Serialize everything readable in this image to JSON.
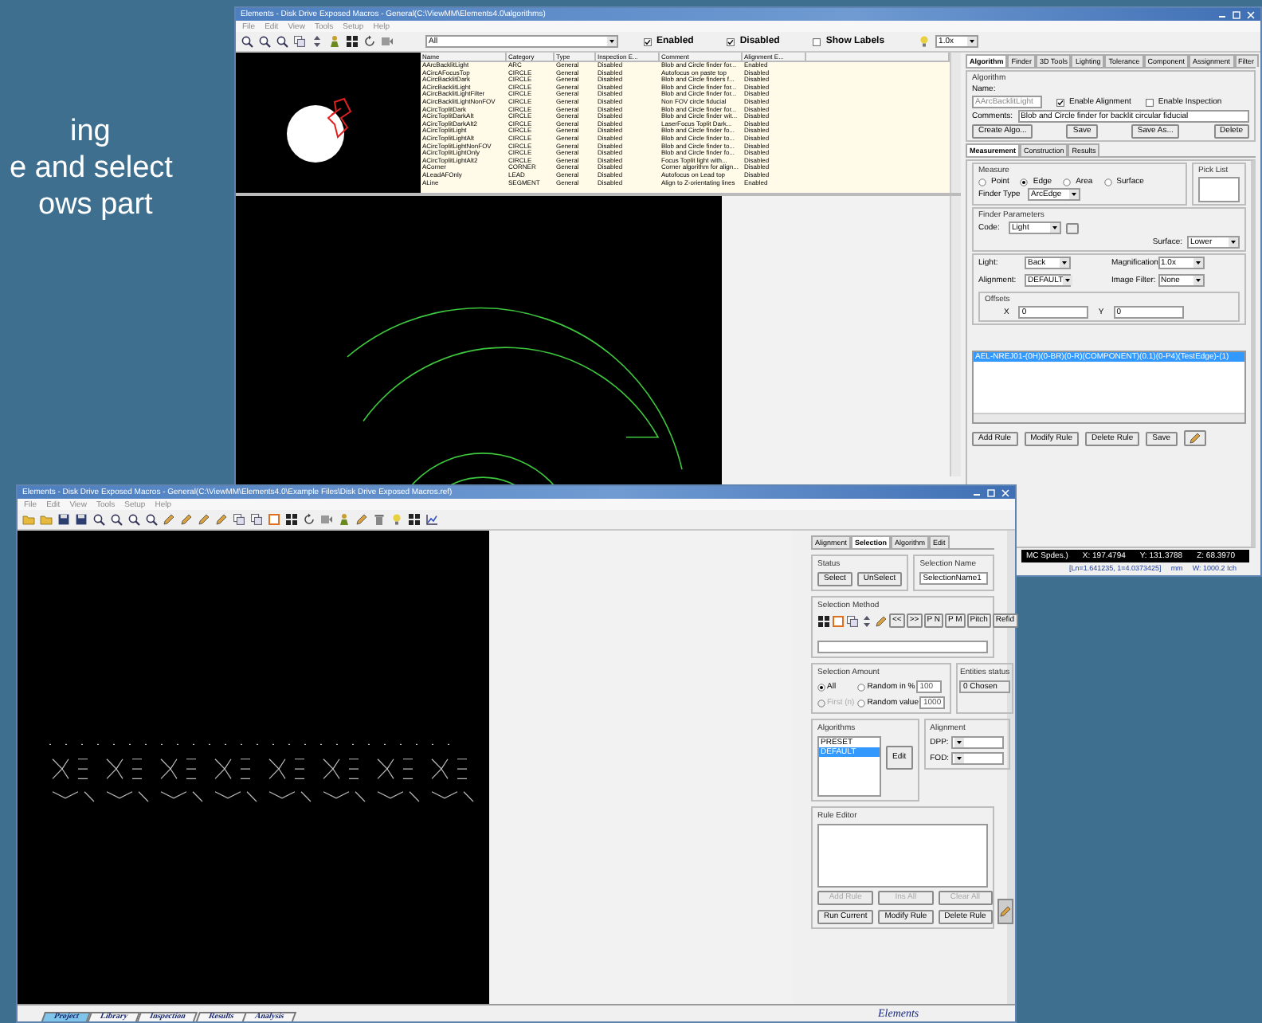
{
  "slide_text": [
    "ing",
    "e and select",
    "ows part"
  ],
  "top_window": {
    "title": "Elements - Disk Drive Exposed Macros - General(C:\\ViewMM\\Elements4.0\\algorithms)",
    "menu": [
      "File",
      "Edit",
      "View",
      "Tools",
      "Setup",
      "Help"
    ],
    "filter": "All",
    "toggles": [
      {
        "label": "Enabled",
        "checked": true
      },
      {
        "label": "Disabled",
        "checked": true
      },
      {
        "label": "Show Labels",
        "checked": false
      }
    ],
    "zoom": "1.0x",
    "table": {
      "columns": [
        "Name",
        "Category",
        "Type",
        "Inspection E...",
        "Comment",
        "Alignment E..."
      ],
      "rows": [
        [
          "AArcBacklitLight",
          "ARC",
          "General",
          "Disabled",
          "Blob and Circle finder for...",
          "Enabled"
        ],
        [
          "ACircAFocusTop",
          "CIRCLE",
          "General",
          "Disabled",
          "Autofocus on paste top",
          "Disabled"
        ],
        [
          "ACircBacklitDark",
          "CIRCLE",
          "General",
          "Disabled",
          "Blob and Circle finders f...",
          "Disabled"
        ],
        [
          "ACircBacklitLight",
          "CIRCLE",
          "General",
          "Disabled",
          "Blob and Circle finder for...",
          "Disabled"
        ],
        [
          "ACircBacklitLightFilter",
          "CIRCLE",
          "General",
          "Disabled",
          "Blob and Circle finder for...",
          "Disabled"
        ],
        [
          "ACircBacklitLightNonFOV",
          "CIRCLE",
          "General",
          "Disabled",
          "Non FOV circle fiducial",
          "Disabled"
        ],
        [
          "ACircToplitDark",
          "CIRCLE",
          "General",
          "Disabled",
          "Blob and Circle finder for...",
          "Disabled"
        ],
        [
          "ACircToplitDarkAlt",
          "CIRCLE",
          "General",
          "Disabled",
          "Blob and Circle finder wit...",
          "Disabled"
        ],
        [
          "ACircToplitDarkAlt2",
          "CIRCLE",
          "General",
          "Disabled",
          "LaserFocus Toplit Dark...",
          "Disabled"
        ],
        [
          "ACircToplitLight",
          "CIRCLE",
          "General",
          "Disabled",
          "Blob and Circle finder fo...",
          "Disabled"
        ],
        [
          "ACircToplitLightAlt",
          "CIRCLE",
          "General",
          "Disabled",
          "Blob and Circle finder to...",
          "Disabled"
        ],
        [
          "ACircToplitLightNonFOV",
          "CIRCLE",
          "General",
          "Disabled",
          "Blob and Circle finder to...",
          "Disabled"
        ],
        [
          "ACircToplitLightOnly",
          "CIRCLE",
          "General",
          "Disabled",
          "Blob and Circle finder fo...",
          "Disabled"
        ],
        [
          "ACircToplitLightAlt2",
          "CIRCLE",
          "General",
          "Disabled",
          "Focus Toplit light with...",
          "Disabled"
        ],
        [
          "ACorner",
          "CORNER",
          "General",
          "Disabled",
          "Corner algorithm for align...",
          "Disabled"
        ],
        [
          "ALeadAFOnly",
          "LEAD",
          "General",
          "Disabled",
          "Autofocus on Lead top",
          "Disabled"
        ],
        [
          "ALine",
          "SEGMENT",
          "General",
          "Disabled",
          "Align to Z-orientating lines",
          "Enabled"
        ]
      ]
    },
    "panel": {
      "tabs": [
        {
          "label": "Algorithm",
          "selected": true
        },
        {
          "label": "Finder",
          "selected": false
        },
        {
          "label": "3D Tools",
          "selected": false
        },
        {
          "label": "Lighting",
          "selected": false
        },
        {
          "label": "Tolerance",
          "selected": false
        },
        {
          "label": "Component",
          "selected": false
        },
        {
          "label": "Assignment",
          "selected": false
        },
        {
          "label": "Filter",
          "selected": false
        }
      ],
      "group_title": "Algorithm",
      "name_label": "Name:",
      "name_value": "AArcBacklitLight",
      "options": [
        {
          "label": "Enable Alignment",
          "checked": true
        },
        {
          "label": "Enable Inspection",
          "checked": false
        }
      ],
      "comments_label": "Comments:",
      "comments_value": "Blob and Circle finder for backlit circular fiducial",
      "buttons": [
        "Create Algo...",
        "Save",
        "Save As...",
        "Delete"
      ],
      "subtabs": [
        {
          "label": "Measurement",
          "selected": true
        },
        {
          "label": "Construction",
          "selected": false
        },
        {
          "label": "Results",
          "selected": false
        }
      ],
      "measure_title": "Measure",
      "measure": [
        {
          "label": "Point",
          "selected": false
        },
        {
          "label": "Edge",
          "selected": true
        },
        {
          "label": "Area",
          "selected": false
        },
        {
          "label": "Surface",
          "selected": false
        }
      ],
      "finder_type_label": "Finder Type",
      "finder_type": "ArcEdge",
      "pick_list_title": "Pick List",
      "finder_params_title": "Finder Parameters",
      "code_label": "Code:",
      "code": "Light",
      "surface_label": "Surface:",
      "surface": "Lower",
      "params": [
        {
          "label": "Light:",
          "value": "Back"
        },
        {
          "label": "Magnification:",
          "value": "1.0x"
        },
        {
          "label": "Alignment:",
          "value": "DEFAULT"
        },
        {
          "label": "Image Filter:",
          "value": "None"
        }
      ],
      "offsets_title": "Offsets",
      "offsets": [
        {
          "label": "X",
          "value": "0"
        },
        {
          "label": "Y",
          "value": "0"
        }
      ],
      "rules": [
        {
          "text": "AEL-NREJ01-(0H)(0-BR)(0-R)(COMPONENT)(0.1)(0-P4)(TestEdge)-(1)",
          "selected": true
        }
      ],
      "rule_buttons": [
        "Add Rule",
        "Modify Rule",
        "Delete Rule",
        "Save"
      ]
    },
    "status": {
      "readouts": [
        "MC Spdes.)",
        "X: 197.4794",
        "Y: 131.3788",
        "Z: 68.3970"
      ],
      "line2": [
        "[Ln=1.641235, 1=4.0373425]",
        "mm",
        "W: 1000.2 Ich"
      ]
    }
  },
  "bottom_window": {
    "title": "Elements - Disk Drive Exposed Macros - General(C:\\ViewMM\\Elements4.0\\Example Files\\Disk Drive Exposed Macros.ref)",
    "menu": [
      "File",
      "Edit",
      "View",
      "Tools",
      "Setup",
      "Help"
    ],
    "panel": {
      "tabs": [
        {
          "label": "Alignment",
          "selected": false
        },
        {
          "label": "Selection",
          "selected": true
        },
        {
          "label": "Algorithm",
          "selected": false
        },
        {
          "label": "Edit",
          "selected": false
        }
      ],
      "status_title": "Status",
      "status_buttons": [
        "Select",
        "UnSelect"
      ],
      "selection_name_title": "Selection Name",
      "selection_name": "SelectionName1",
      "method_title": "Selection Method",
      "method_buttons": [
        "<<",
        ">>",
        "P N",
        "P M",
        "Pitch",
        "Refid"
      ],
      "amount_title": "Selection Amount",
      "amount": [
        {
          "label": "All",
          "selected": true,
          "disabled": false
        },
        {
          "label": "Random in %",
          "selected": false,
          "disabled": false,
          "value": "100"
        },
        {
          "label": "First (n)",
          "selected": false,
          "disabled": true
        },
        {
          "label": "Random value",
          "selected": false,
          "disabled": false,
          "value": "1000"
        }
      ],
      "entities_title": "Entities status",
      "entities": "0 Chosen",
      "algorithms_title": "Algorithms",
      "algorithms": [
        {
          "label": "PRESET",
          "selected": false
        },
        {
          "label": "DEFAULT",
          "selected": true
        }
      ],
      "edit_button": "Edit",
      "alignment_title": "Alignment",
      "alignment_fields": [
        "DPP:",
        "FOD:"
      ],
      "rule_editor_title": "Rule Editor",
      "rule_buttons": [
        {
          "label": "Add Rule",
          "disabled": true
        },
        {
          "label": "Ins All",
          "disabled": true
        },
        {
          "label": "Clear All",
          "disabled": true
        },
        {
          "label": "Run Current",
          "disabled": false
        },
        {
          "label": "Modify Rule",
          "disabled": false
        },
        {
          "label": "Delete Rule",
          "disabled": false
        }
      ]
    },
    "bottom_tabs": [
      {
        "label": "Project",
        "selected": true
      },
      {
        "label": "Library",
        "selected": false
      },
      {
        "label": "Inspection",
        "selected": false
      },
      {
        "label": "Results",
        "selected": false
      },
      {
        "label": "Analysis",
        "selected": false
      }
    ],
    "logo": "Elements"
  }
}
